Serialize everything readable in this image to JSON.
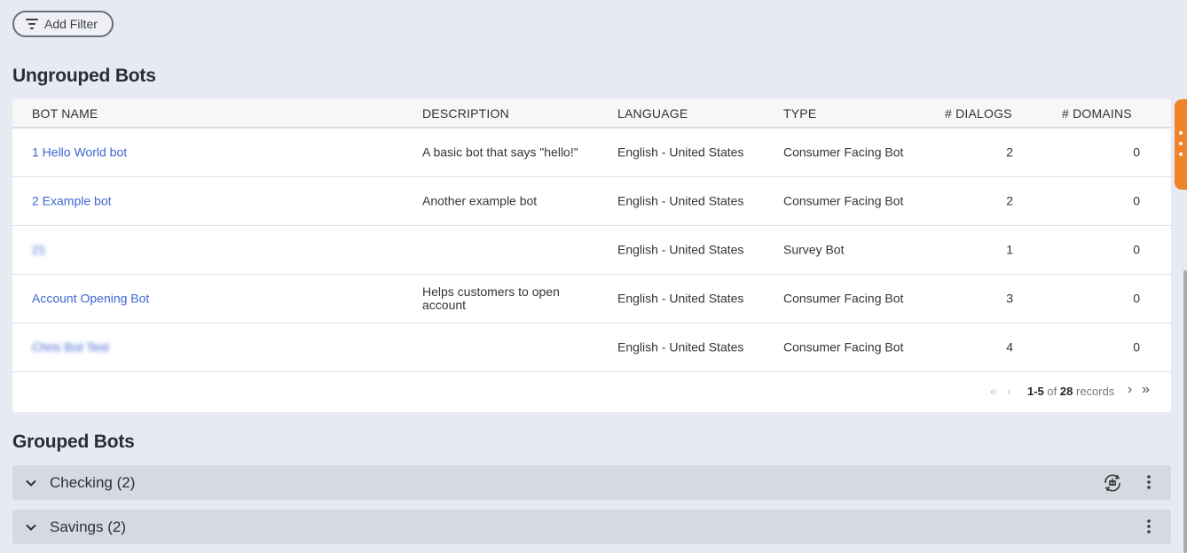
{
  "filter": {
    "label": "Add Filter"
  },
  "ungrouped": {
    "title": "Ungrouped Bots",
    "columns": [
      "BOT NAME",
      "DESCRIPTION",
      "LANGUAGE",
      "TYPE",
      "# DIALOGS",
      "# DOMAINS"
    ],
    "rows": [
      {
        "name": "1 Hello World bot",
        "description": "A basic bot that says \"hello!\"",
        "language": "English - United States",
        "type": "Consumer Facing Bot",
        "dialogs": "2",
        "domains": "0"
      },
      {
        "name": "2 Example bot",
        "description": "Another example bot",
        "language": "English - United States",
        "type": "Consumer Facing Bot",
        "dialogs": "2",
        "domains": "0"
      },
      {
        "name": "21",
        "description": "",
        "language": "English - United States",
        "type": "Survey Bot",
        "dialogs": "1",
        "domains": "0"
      },
      {
        "name": "Account Opening Bot",
        "description": "Helps customers to open account",
        "language": "English - United States",
        "type": "Consumer Facing Bot",
        "dialogs": "3",
        "domains": "0"
      },
      {
        "name": "Chris Bot Test",
        "description": "",
        "language": "English - United States",
        "type": "Consumer Facing Bot",
        "dialogs": "4",
        "domains": "0"
      }
    ],
    "pager": {
      "range": "1-5",
      "of": "of",
      "total": "28",
      "suffix": "records"
    }
  },
  "grouped": {
    "title": "Grouped Bots",
    "groups": [
      {
        "label": "Checking (2)"
      },
      {
        "label": "Savings (2)"
      }
    ]
  },
  "icons": {
    "filter": "filter-icon",
    "chevron": "chevron-down-icon",
    "kebab": "more-vertical-icon",
    "bot_sync": "bot-sync-icon",
    "first": "first-page-icon",
    "prev": "prev-page-icon",
    "next": "next-page-icon",
    "last": "last-page-icon"
  },
  "colors": {
    "link": "#3f67d1",
    "accent_tab": "#f0832a",
    "background": "#e7eaf3"
  }
}
